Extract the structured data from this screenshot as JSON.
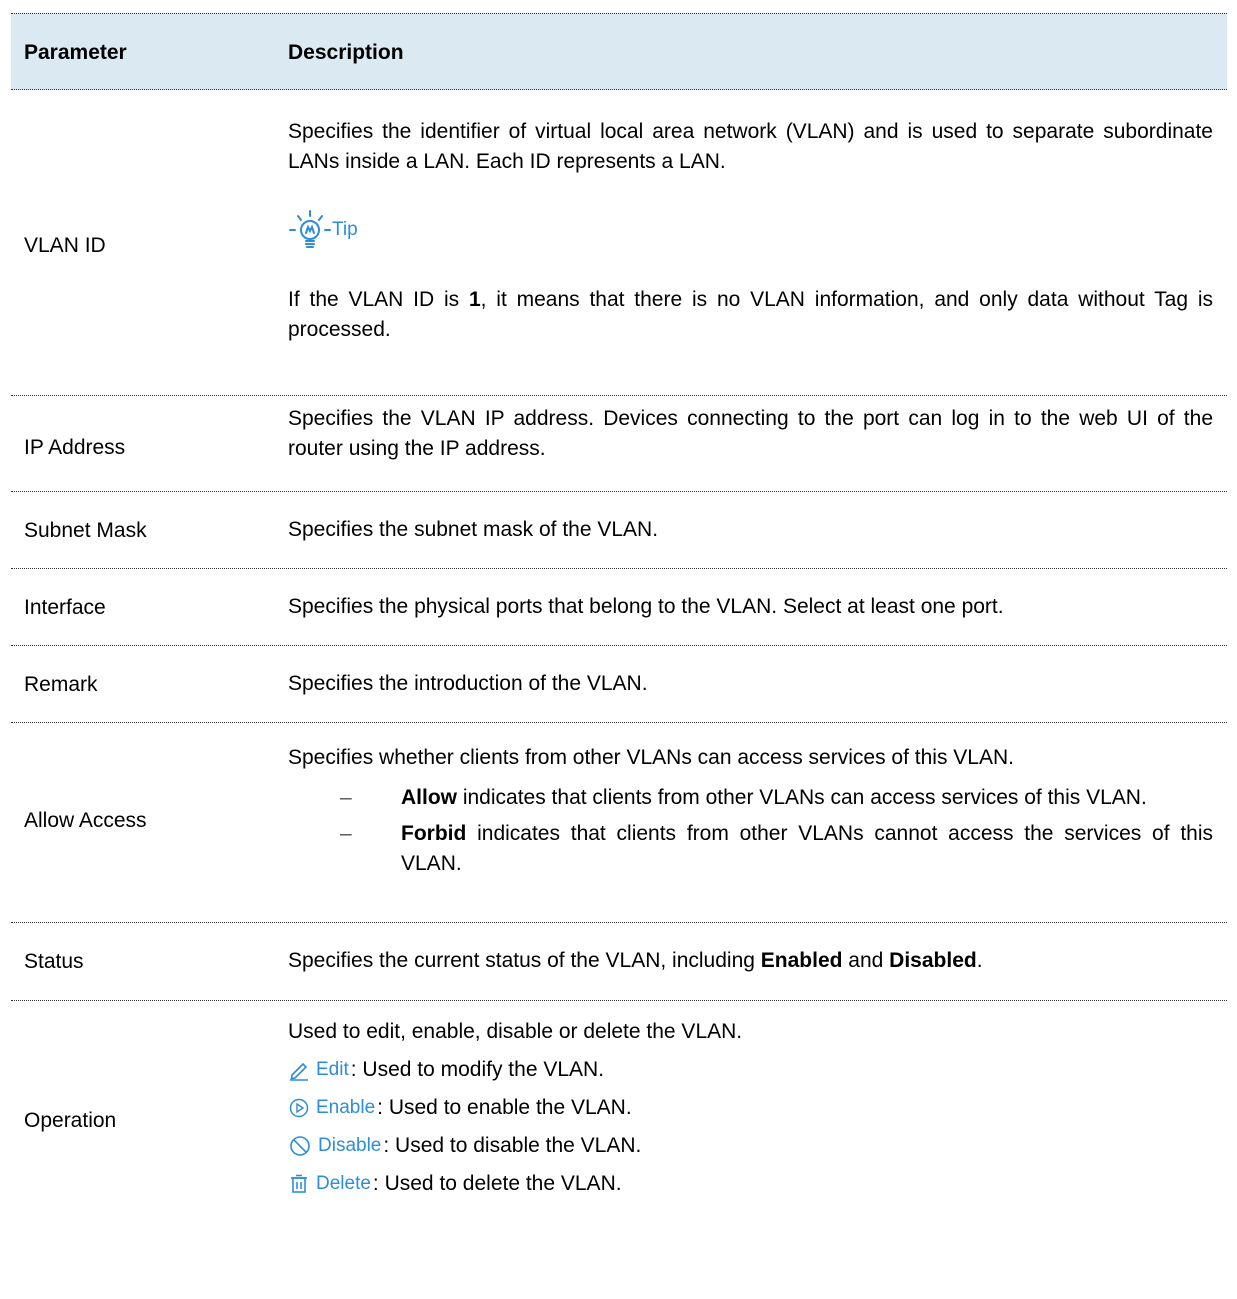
{
  "table": {
    "header": {
      "parameter": "Parameter",
      "description": "Description"
    },
    "rows": [
      {
        "parameter": "VLAN ID",
        "desc1": "Specifies the identifier of virtual local area network (VLAN) and is used to separate subordinate LANs inside a LAN. Each ID represents a LAN.",
        "tip_label": "Tip",
        "tip_pre": "If the VLAN ID is ",
        "tip_bold": "1",
        "tip_post": ", it means that there is no VLAN information, and only data without Tag is processed."
      },
      {
        "parameter": "IP Address",
        "desc": "Specifies the VLAN IP address. Devices connecting to the port can log in to the web UI of the router using the IP address."
      },
      {
        "parameter": "Subnet Mask",
        "desc": "Specifies the subnet mask of the VLAN."
      },
      {
        "parameter": "Interface",
        "desc": "Specifies the physical ports that belong to the VLAN. Select at least one port."
      },
      {
        "parameter": "Remark",
        "desc": "Specifies the introduction of the VLAN."
      },
      {
        "parameter": "Allow Access",
        "desc": "Specifies whether clients from other VLANs can access services of this VLAN.",
        "bullets": [
          {
            "dash": "–",
            "bold": "Allow",
            "text": " indicates that clients from other VLANs can access services of this VLAN."
          },
          {
            "dash": "–",
            "bold": "Forbid",
            "text": " indicates that clients from other VLANs cannot access the services of this VLAN."
          }
        ]
      },
      {
        "parameter": "Status",
        "desc_pre": "Specifies the current status of the VLAN, including ",
        "bold1": "Enabled",
        "mid": " and ",
        "bold2": "Disabled",
        "post": "."
      },
      {
        "parameter": "Operation",
        "desc": "Used to edit, enable, disable or delete the VLAN.",
        "ops": [
          {
            "icon": "pencil-icon",
            "label": "Edit",
            "text": ": Used to modify the VLAN."
          },
          {
            "icon": "play-circle-icon",
            "label": "Enable",
            "text": ": Used to enable the VLAN."
          },
          {
            "icon": "prohibit-icon",
            "label": "Disable",
            "text": ": Used to disable the VLAN."
          },
          {
            "icon": "trash-icon",
            "label": "Delete",
            "text": ": Used to delete the VLAN."
          }
        ]
      }
    ]
  },
  "colors": {
    "header_bg": "#dbe9f2",
    "accent": "#2e8dd8"
  }
}
